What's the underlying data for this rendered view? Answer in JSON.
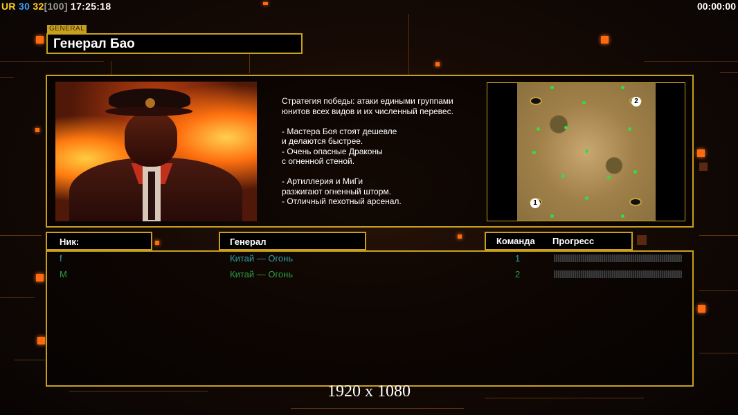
{
  "hud": {
    "tag": "UR",
    "fps": "30",
    "frame": "32",
    "frame_limit": "[100]",
    "clock": "17:25:18",
    "timer": "00:00:00"
  },
  "general_tag": "GENERAL",
  "general_name": "Генерал Бао",
  "description": {
    "intro_1": "Стратегия победы: атаки едиными группами",
    "intro_2": "юнитов всех видов и их численный перевес.",
    "b1_1": "- Мастера Боя стоят дешевле",
    "b1_2": "и делаются быстрее.",
    "b2_1": "- Очень опасные Драконы",
    "b2_2": "с огненной стеной.",
    "b3_1": "- Артиллерия и МиГи",
    "b3_2": "разжигают огненный шторм.",
    "b4": "- Отличный пехотный арсенал."
  },
  "map": {
    "spawn_1": "1",
    "spawn_2": "2"
  },
  "table_headers": {
    "nick": "Ник:",
    "general": "Генерал",
    "team": "Команда",
    "progress": "Прогресс"
  },
  "players": [
    {
      "nick": "f",
      "general": "Китай — Огонь",
      "team": "1",
      "color": "#2aa0a8",
      "progress": 0
    },
    {
      "nick": "M",
      "general": "Китай — Огонь",
      "team": "2",
      "color": "#2aa040",
      "progress": 0
    }
  ],
  "resolution_label": "1920 x 1080",
  "colors": {
    "accent_gold": "#c8a020",
    "hud_fps": "#3a9fff",
    "hud_frame": "#ffd020",
    "hud_limit": "#9a9a9a",
    "hud_tag": "#ffd020"
  }
}
